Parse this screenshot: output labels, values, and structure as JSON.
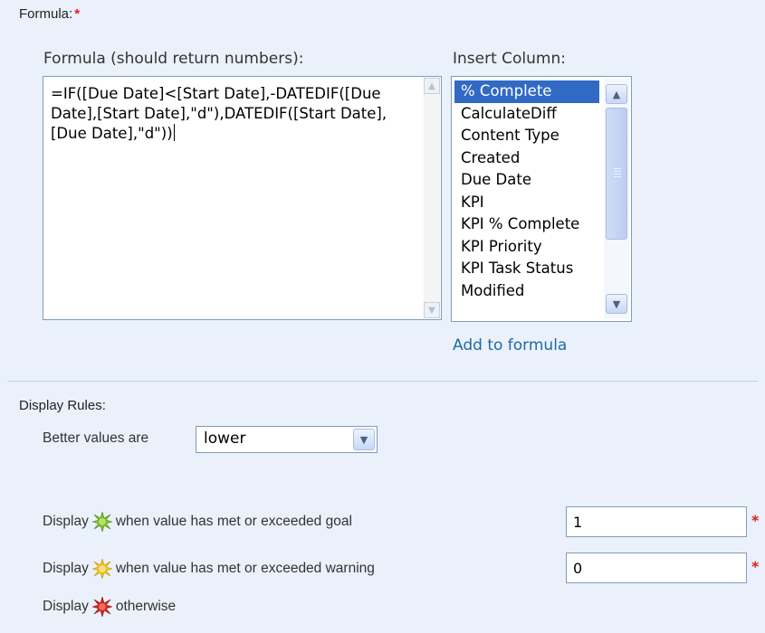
{
  "formula_section": {
    "label": "Formula:",
    "required_mark": "*",
    "formula_header": "Formula (should return numbers):",
    "formula_value": "=IF([Due Date]<[Start Date],-DATEDIF([Due Date],[Start Date],\"d\"),DATEDIF([Start Date],[Due Date],\"d\"))",
    "insert_column_header": "Insert Column:",
    "columns": [
      "% Complete",
      "CalculateDiff",
      "Content Type",
      "Created",
      "Due Date",
      "KPI",
      "KPI % Complete",
      "KPI Priority",
      "KPI Task Status",
      "Modified"
    ],
    "selected_column": "% Complete",
    "add_link": "Add to formula"
  },
  "display_rules": {
    "label": "Display Rules:",
    "better_values_label": "Better values are",
    "better_values_selected": "lower",
    "rows": [
      {
        "prefix": "Display",
        "icon": "green-star-icon",
        "icon_color": "#7dc22c",
        "suffix": "when value has met or exceeded goal",
        "value": "1",
        "required_mark": "*"
      },
      {
        "prefix": "Display",
        "icon": "yellow-star-icon",
        "icon_color": "#f5c518",
        "suffix": "when value has met or exceeded warning",
        "value": "0",
        "required_mark": "*"
      },
      {
        "prefix": "Display",
        "icon": "red-star-icon",
        "icon_color": "#d9241b",
        "suffix": "otherwise"
      }
    ]
  },
  "colors": {
    "background": "#eaf1fa",
    "selection": "#316ac5",
    "link": "#1f6aa7",
    "required": "#e41b17"
  }
}
